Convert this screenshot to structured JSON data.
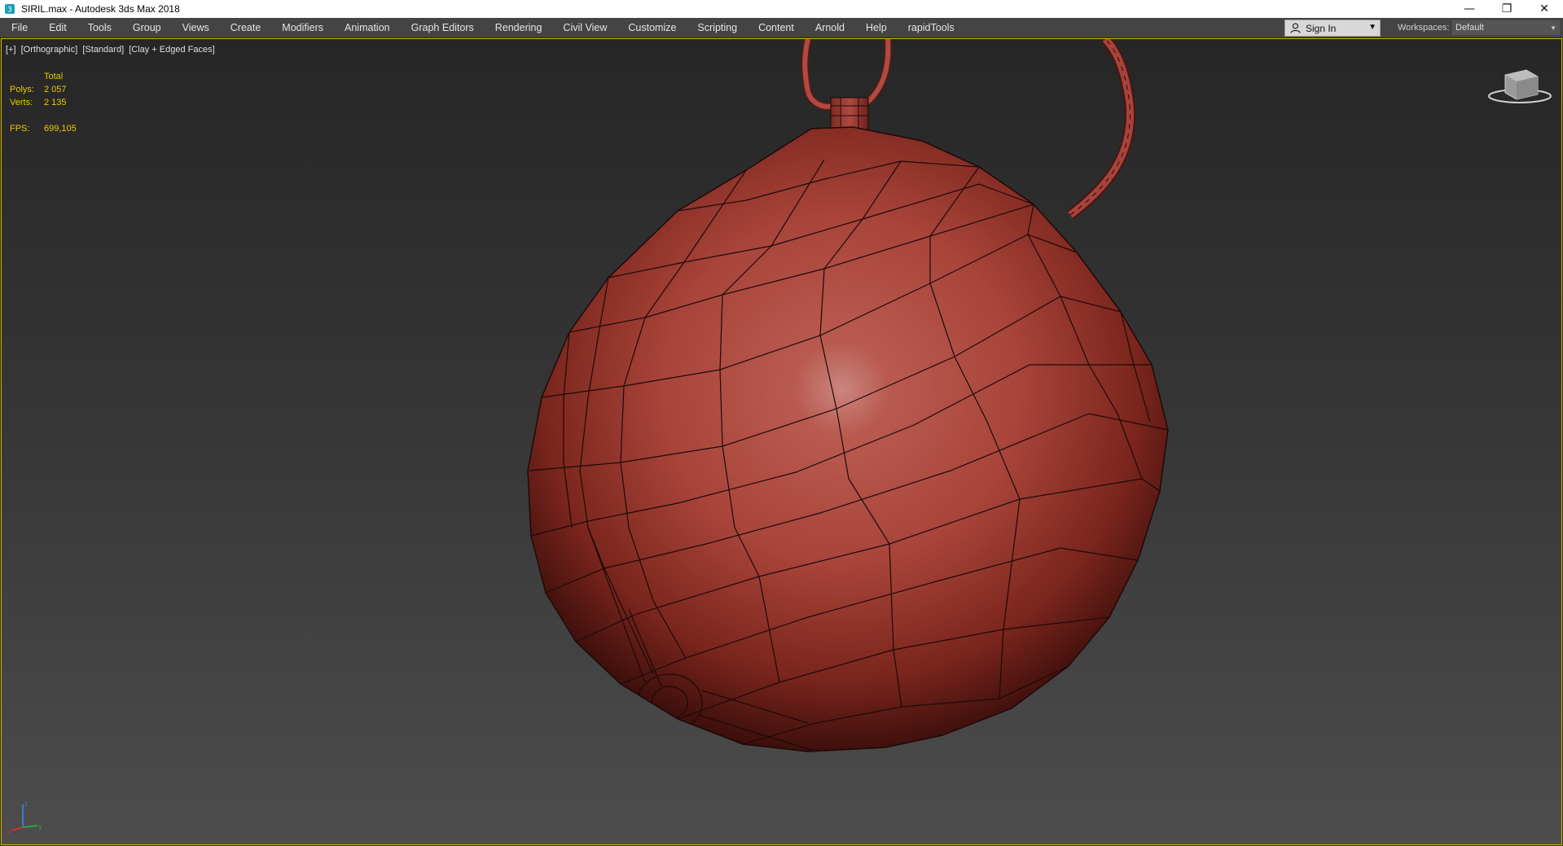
{
  "window": {
    "title": "SIRIL.max - Autodesk 3ds Max 2018",
    "controls": {
      "minimize": "—",
      "restore": "❐",
      "close": "✕"
    }
  },
  "menu": {
    "items": [
      "File",
      "Edit",
      "Tools",
      "Group",
      "Views",
      "Create",
      "Modifiers",
      "Animation",
      "Graph Editors",
      "Rendering",
      "Civil View",
      "Customize",
      "Scripting",
      "Content",
      "Arnold",
      "Help",
      "rapidTools"
    ],
    "sign_in": "Sign In",
    "workspaces_label": "Workspaces:",
    "workspace_value": "Default"
  },
  "viewport": {
    "labels": [
      "[+]",
      "[Orthographic]",
      "[Standard]",
      "[Clay + Edged Faces]"
    ],
    "stats": {
      "header": "Total",
      "polys_label": "Polys:",
      "polys_value": "2 057",
      "verts_label": "Verts:",
      "verts_value": "2 135",
      "fps_label": "FPS:",
      "fps_value": "699,105"
    },
    "viewcube_icon": "viewcube-icon",
    "axis_icon": "axis-tripod-icon"
  },
  "colors": {
    "menubar": "#444444",
    "viewport_border": "#d8b400",
    "stats_text": "#e8c800",
    "mesh_base": "#b8443a",
    "mesh_edge": "#1c0a08"
  }
}
